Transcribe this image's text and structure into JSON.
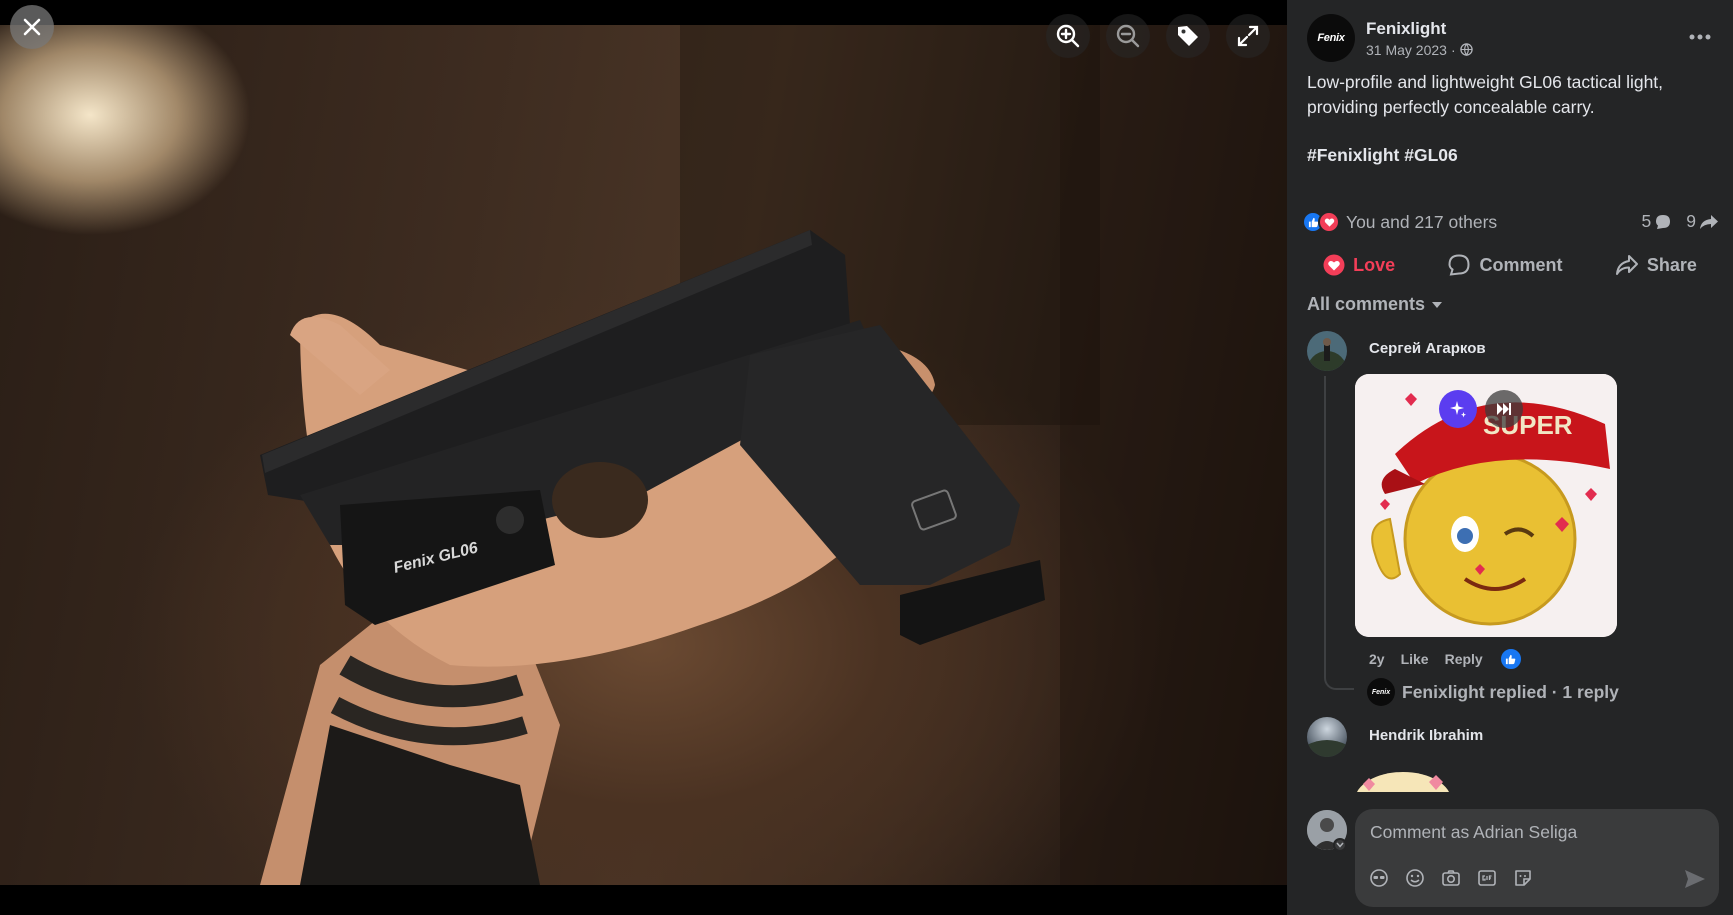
{
  "viewer": {
    "photo_alt": "Hand holding a black pistol with a Fenix GL06 tactical light attached",
    "light_label": "Fenix GL06",
    "tools": [
      "zoom-in",
      "zoom-out",
      "tag",
      "fullscreen"
    ]
  },
  "post": {
    "page_name": "Fenixlight",
    "avatar_text": "Fenix",
    "date": "31 May 2023",
    "audience_separator": "·",
    "caption": "Low-profile and lightweight GL06 tactical light, providing perfectly concealable carry.",
    "hashtags": [
      "#Fenixlight",
      "#GL06"
    ]
  },
  "reactions": {
    "summary": "You and 217 others",
    "comment_count": "5",
    "share_count": "9",
    "colors": {
      "like": "#1877f2",
      "love": "#f33e58"
    }
  },
  "actions": {
    "love": "Love",
    "comment": "Comment",
    "share": "Share"
  },
  "comments": {
    "filter_label": "All comments",
    "items": [
      {
        "author": "Сергей Агарков",
        "gif_text": "SUPER",
        "age": "2y",
        "like": "Like",
        "reply": "Reply",
        "replied_text": "Fenixlight replied · 1 reply"
      },
      {
        "author": "Hendrik Ibrahim"
      }
    ]
  },
  "composer": {
    "placeholder": "Comment as Adrian Seliga"
  }
}
